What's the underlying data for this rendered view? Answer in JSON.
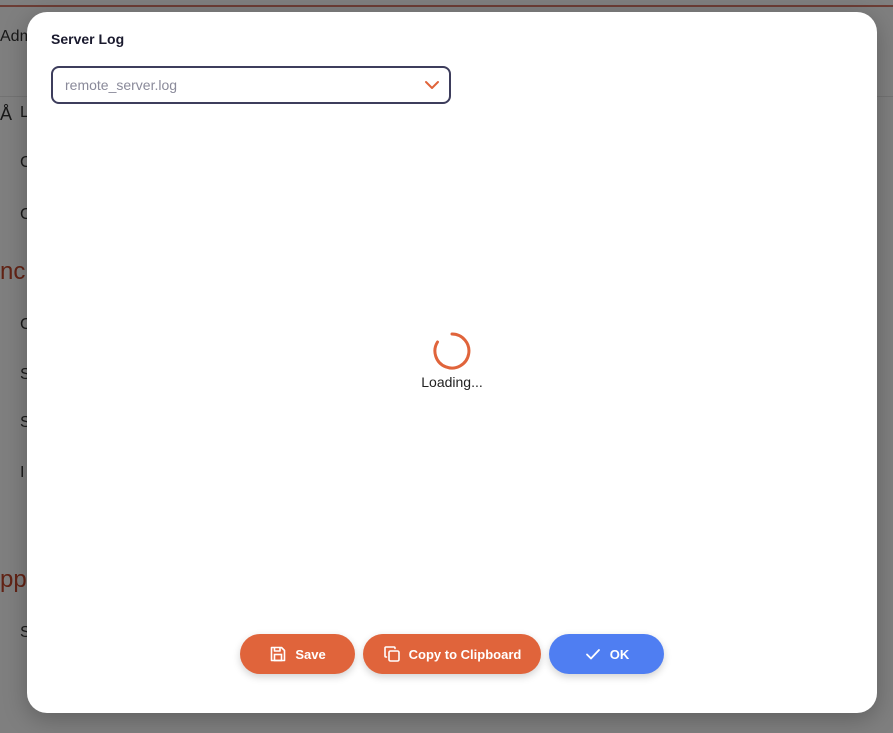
{
  "background": {
    "header_text": "Adm",
    "rows": [
      "L",
      "C",
      "C",
      "C",
      "S",
      "S",
      "I",
      "S"
    ],
    "sections": [
      "nc",
      "pp"
    ],
    "icon_glyph": "Å"
  },
  "modal": {
    "title": "Server Log",
    "select": {
      "value": "remote_server.log"
    },
    "loading_text": "Loading...",
    "buttons": {
      "save": "Save",
      "copy": "Copy to Clipboard",
      "ok": "OK"
    }
  },
  "colors": {
    "accent": "#e0643b",
    "primary": "#4f7ef2"
  }
}
